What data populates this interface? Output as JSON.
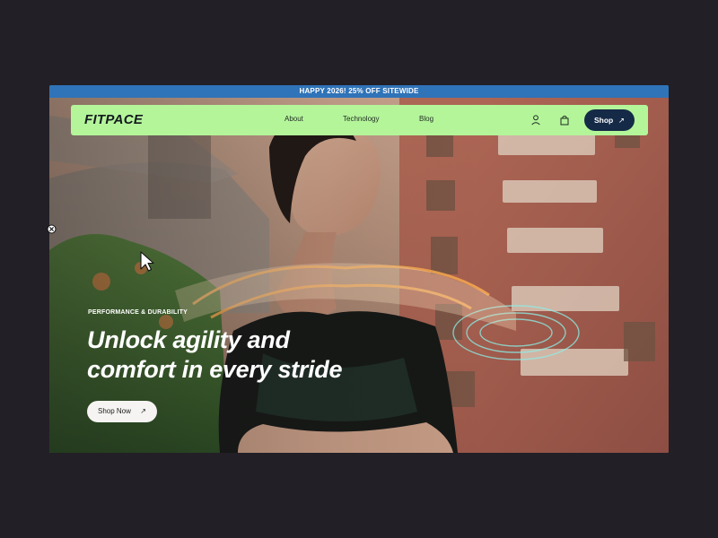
{
  "promo": {
    "text": "HAPPY 2026! 25% OFF SITEWIDE"
  },
  "navbar": {
    "brand": "FITPACE",
    "links": [
      "About",
      "Technology",
      "Blog"
    ],
    "shop_label": "Shop",
    "shop_arrow": "↗",
    "icons": [
      "user-icon",
      "bag-icon"
    ]
  },
  "hero": {
    "eyebrow": "PERFORMANCE & DURABILITY",
    "heading_lines": [
      "Unlock agility and",
      "comfort in every stride"
    ],
    "cta_label": "Shop Now",
    "cta_arrow": "↗"
  },
  "overlay": {
    "close_icon": "close-icon",
    "cursor_icon": "cursor-icon"
  },
  "colors": {
    "page_background": "#221f26",
    "promo_background": "#2f73b8",
    "navbar_background": "#b4f59a",
    "shop_button_background": "#152a47",
    "cta_background": "#f5f4f2"
  }
}
